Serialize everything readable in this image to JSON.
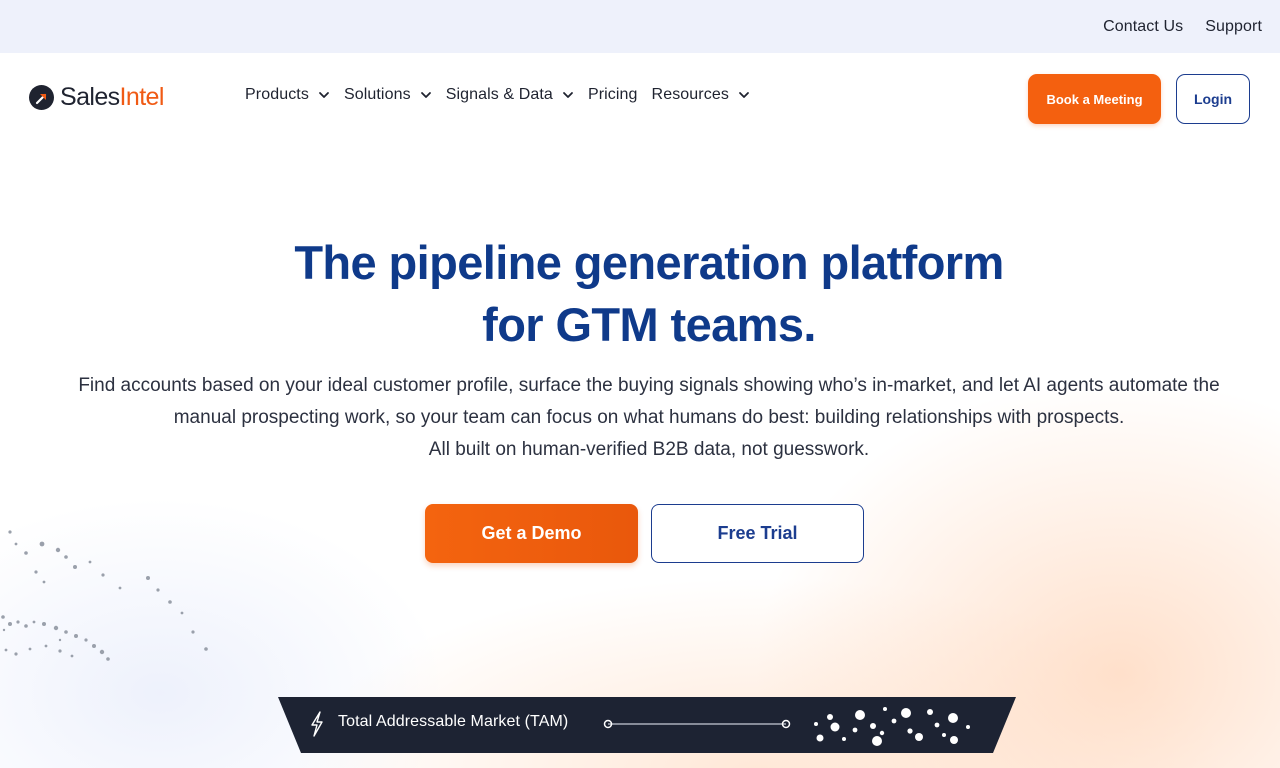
{
  "utility_bar": {
    "contact_label": "Contact Us",
    "support_label": "Support"
  },
  "brand": {
    "name_part1": "Sales",
    "name_part2": "Intel",
    "accent_color": "#f05a14",
    "primary_color": "#0f3a8a"
  },
  "nav": {
    "items": [
      {
        "label": "Products",
        "has_dropdown": true
      },
      {
        "label": "Solutions",
        "has_dropdown": true
      },
      {
        "label": "Signals & Data",
        "has_dropdown": true
      },
      {
        "label": "Pricing",
        "has_dropdown": false
      },
      {
        "label": "Resources",
        "has_dropdown": true
      }
    ],
    "book_meeting_label": "Book a Meeting",
    "login_label": "Login"
  },
  "hero": {
    "title_line1": "The pipeline generation platform",
    "title_line2": "for GTM teams.",
    "desc_line1": "Find accounts based on your ideal customer profile, surface the buying signals showing who’s in-market, and let AI agents automate the",
    "desc_line2": "manual prospecting work, so your team can focus on what humans do best: building relationships with prospects.",
    "desc_line3": "All built on human-verified B2B data, not guesswork.",
    "demo_label": "Get a Demo",
    "trial_label": "Free Trial"
  },
  "tam_bar": {
    "icon": "lightning-icon",
    "label": "Total Addressable Market (TAM)"
  }
}
